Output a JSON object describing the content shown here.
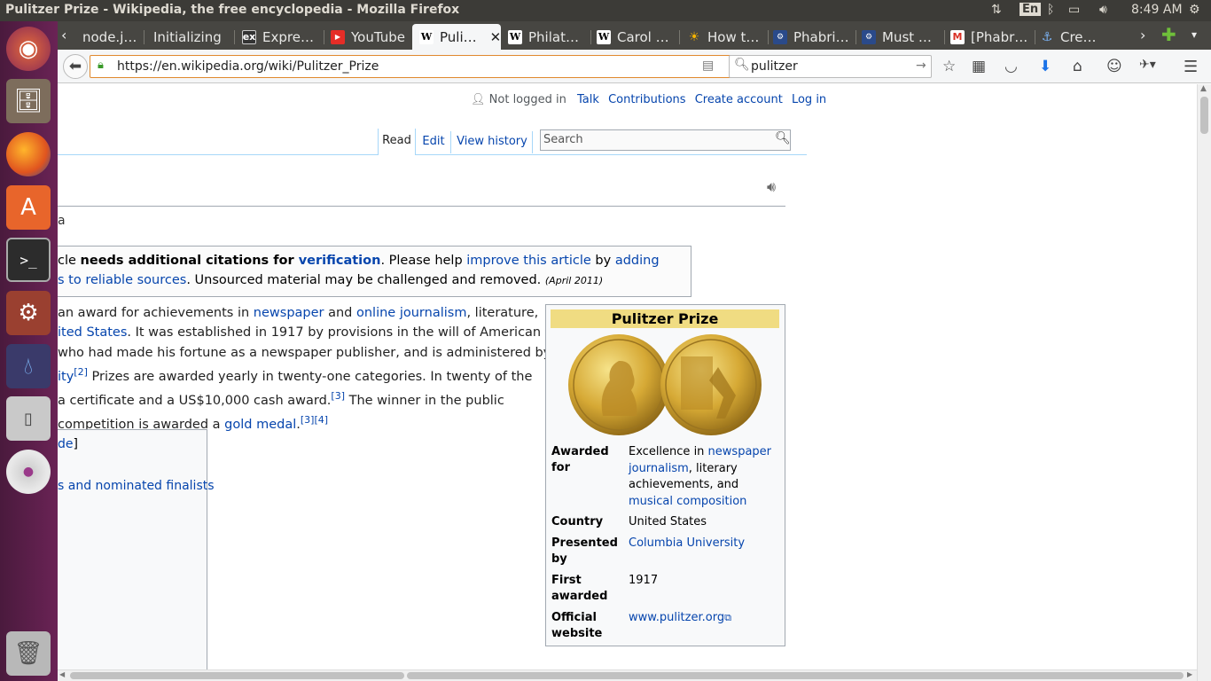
{
  "window": {
    "title": "Pulitzer Prize - Wikipedia, the free encyclopedia - Mozilla Firefox"
  },
  "tray": {
    "lang": "En",
    "time": "8:49 AM"
  },
  "tabs": [
    {
      "label": "node.j…",
      "icon": "generic"
    },
    {
      "label": "Initializing",
      "icon": "none"
    },
    {
      "label": "Expre…",
      "icon": "ex"
    },
    {
      "label": "YouTube",
      "icon": "youtube"
    },
    {
      "label": "Puli…",
      "icon": "wikipedia",
      "active": true
    },
    {
      "label": "Philat…",
      "icon": "wikipedia"
    },
    {
      "label": "Carol …",
      "icon": "wikipedia"
    },
    {
      "label": "How t…",
      "icon": "sun"
    },
    {
      "label": "Phabri…",
      "icon": "phabricator"
    },
    {
      "label": "Must …",
      "icon": "phabricator"
    },
    {
      "label": "[Phabr…",
      "icon": "gmail"
    },
    {
      "label": "Cre…",
      "icon": "anchor"
    }
  ],
  "navbar": {
    "url": "https://en.wikipedia.org/wiki/Pulitzer_Prize",
    "search_value": "pulitzer"
  },
  "wiki": {
    "personal": {
      "not_logged_in": "Not logged in",
      "talk": "Talk",
      "contributions": "Contributions",
      "create_account": "Create account",
      "log_in": "Log in"
    },
    "views": {
      "read": "Read",
      "edit": "Edit",
      "view_history": "View history"
    },
    "search_placeholder": "Search",
    "from_fragment": "a",
    "notice": {
      "l1_a": "cle ",
      "l1_b": "needs additional citations for ",
      "l1_c": "verification",
      "l1_d": ". Please help ",
      "l1_e": "improve this article",
      "l1_f": " by ",
      "l1_g": "adding",
      "l2_a": "s to reliable sources",
      "l2_b": ". Unsourced material may be challenged and removed. ",
      "l2_c": "(April 2011)"
    },
    "lead": {
      "l1_a": " an award for achievements in ",
      "l1_b": "newspaper",
      "l1_c": " and ",
      "l1_d": "online journalism",
      "l1_e": ", literature,",
      "l2_a": "ited States",
      "l2_b": ". It was established in 1917 by provisions in the will of American",
      "l3_a": "who had made his fortune as a newspaper publisher, and is administered by",
      "l4_a": "ity",
      "l4_b": "[2]",
      "l4_c": " Prizes are awarded yearly in twenty-one categories. In twenty of the",
      "l5_a": " a certificate and a US$10,000 cash award.",
      "l5_b": "[3]",
      "l5_c": " The winner in the public",
      "l6_a": " competition is awarded a ",
      "l6_b": "gold medal",
      "l6_c": ".",
      "l6_d": "[3][4]"
    },
    "toc": {
      "item1": "de",
      "item1_bracket": "]",
      "item2": "s and nominated finalists"
    },
    "infobox": {
      "title": "Pulitzer Prize",
      "awarded_for_label_1": "Awarded",
      "awarded_for_label_2": "for",
      "awarded_for_v1": "Excellence in ",
      "awarded_for_v1_link": "newspaper",
      "awarded_for_v2_link": "journalism",
      "awarded_for_v2": ", literary",
      "awarded_for_v3": "achievements, and",
      "awarded_for_v4_link": "musical composition",
      "country_label": "Country",
      "country": "United States",
      "presented_label_1": "Presented",
      "presented_label_2": "by",
      "presented": "Columbia University",
      "first_label_1": "First",
      "first_label_2": "awarded",
      "first": "1917",
      "official_label_1": "Official",
      "official_label_2": "website",
      "official": "www.pulitzer.org"
    }
  },
  "colors": {
    "link": "#0645ad",
    "infobox_header": "#f0dc82",
    "launcher": "#5b1d4a"
  }
}
